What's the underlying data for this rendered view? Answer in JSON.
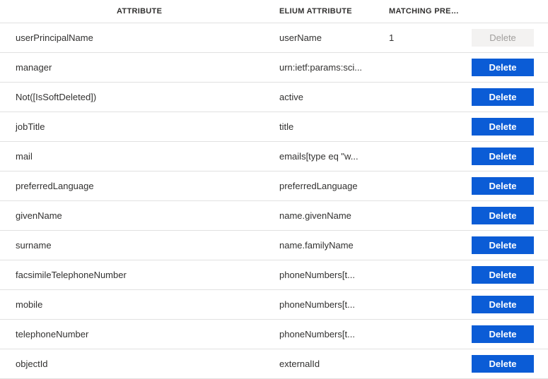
{
  "headers": {
    "attribute": "ATTRIBUTE",
    "elium": "ELIUM ATTRIBUTE",
    "matching": "MATCHING PREC..."
  },
  "delete_label": "Delete",
  "rows": [
    {
      "attribute": "userPrincipalName",
      "elium": "userName",
      "matching": "1",
      "deletable": false
    },
    {
      "attribute": "manager",
      "elium": "urn:ietf:params:sci...",
      "matching": "",
      "deletable": true
    },
    {
      "attribute": "Not([IsSoftDeleted])",
      "elium": "active",
      "matching": "",
      "deletable": true
    },
    {
      "attribute": "jobTitle",
      "elium": "title",
      "matching": "",
      "deletable": true
    },
    {
      "attribute": "mail",
      "elium": "emails[type eq \"w...",
      "matching": "",
      "deletable": true
    },
    {
      "attribute": "preferredLanguage",
      "elium": "preferredLanguage",
      "matching": "",
      "deletable": true
    },
    {
      "attribute": "givenName",
      "elium": "name.givenName",
      "matching": "",
      "deletable": true
    },
    {
      "attribute": "surname",
      "elium": "name.familyName",
      "matching": "",
      "deletable": true
    },
    {
      "attribute": "facsimileTelephoneNumber",
      "elium": "phoneNumbers[t...",
      "matching": "",
      "deletable": true
    },
    {
      "attribute": "mobile",
      "elium": "phoneNumbers[t...",
      "matching": "",
      "deletable": true
    },
    {
      "attribute": "telephoneNumber",
      "elium": "phoneNumbers[t...",
      "matching": "",
      "deletable": true
    },
    {
      "attribute": "objectId",
      "elium": "externalId",
      "matching": "",
      "deletable": true
    }
  ]
}
